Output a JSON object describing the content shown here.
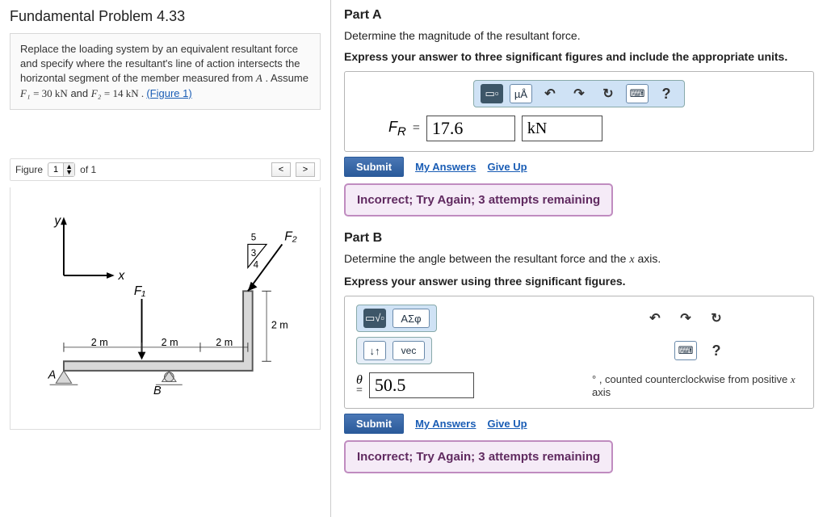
{
  "header": {
    "title": "Fundamental Problem 4.33"
  },
  "description": {
    "text_before": "Replace the loading system by an equivalent resultant force and specify where the resultant's line of action intersects the horizontal segment of the member measured from ",
    "A": "A",
    "assume": ". Assume ",
    "F1": "F₁",
    "eq1": " = 30 kN",
    "and": " and ",
    "F2": "F₂",
    "eq2": " = 14 kN . ",
    "figlink": "(Figure 1)"
  },
  "figure_panel": {
    "label": "Figure",
    "current": "1",
    "of": " of 1"
  },
  "figure": {
    "y": "y",
    "x": "x",
    "F1": "F₁",
    "F2": "F₂",
    "A": "A",
    "B": "B",
    "d1": "2 m",
    "d2": "2 m",
    "d3": "2 m",
    "d4": "2 m",
    "tr5": "5",
    "tr4": "4",
    "tr3": "3"
  },
  "part_a": {
    "title": "Part A",
    "q": "Determine the magnitude of the resultant force.",
    "instr": "Express your answer to three significant figures and include the appropriate units.",
    "tools": {
      "t1": "▭▫",
      "t2": "µÅ",
      "undo": "↶",
      "redo": "↷",
      "reset": "↻",
      "kbd": "⌨",
      "help": "?"
    },
    "var_html": "F<sub>R</sub>",
    "eq": "=",
    "value": "17.6",
    "unit": "kN",
    "submit": "Submit",
    "my_answers": "My Answers",
    "giveup": "Give Up",
    "feedback": "Incorrect; Try Again; 3 attempts remaining"
  },
  "part_b": {
    "title": "Part B",
    "q_pre": "Determine the angle between the resultant force and the ",
    "q_var": "x",
    "q_post": " axis.",
    "instr": "Express your answer using three significant figures.",
    "tools": {
      "t1": "▭√▫",
      "t2": "ΑΣφ",
      "dd": "↓↑",
      "vec": "vec",
      "undo": "↶",
      "redo": "↷",
      "reset": "↻",
      "kbd": "⌨",
      "help": "?"
    },
    "var": "θ",
    "eq": "=",
    "value": "50.5",
    "deg": "°",
    "postfix_pre": ", counted counterclockwise from positive ",
    "postfix_var": "x",
    "postfix_post": " axis",
    "submit": "Submit",
    "my_answers": "My Answers",
    "giveup": "Give Up",
    "feedback": "Incorrect; Try Again; 3 attempts remaining"
  }
}
